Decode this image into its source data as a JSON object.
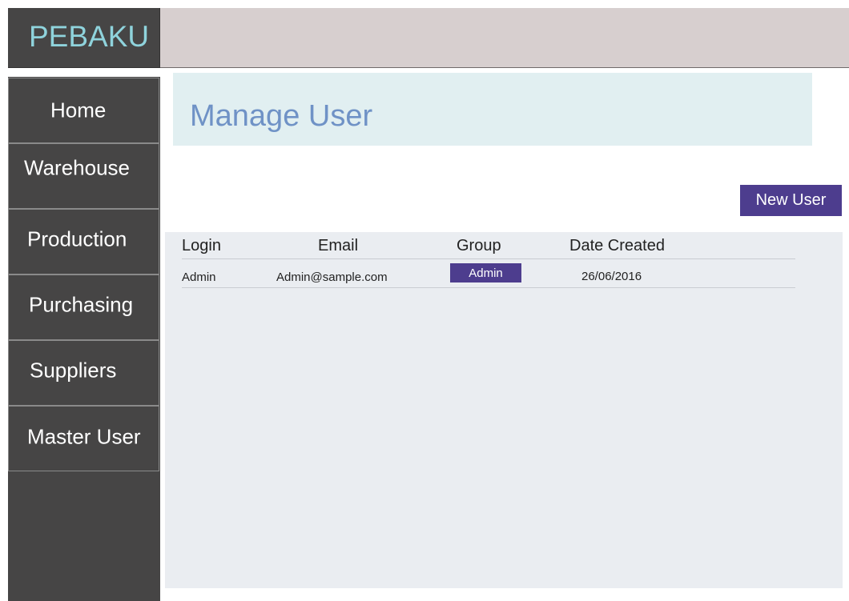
{
  "app": {
    "brand": "PEBAKU"
  },
  "sidebar": {
    "items": [
      {
        "label": "Home"
      },
      {
        "label": "Warehouse"
      },
      {
        "label": "Production"
      },
      {
        "label": "Purchasing"
      },
      {
        "label": "Suppliers"
      },
      {
        "label": "Master User"
      }
    ]
  },
  "main": {
    "title": "Manage User",
    "new_user_label": "New User",
    "table": {
      "columns": [
        "Login",
        "Email",
        "Group",
        "Date Created"
      ],
      "rows": [
        {
          "login": "Admin",
          "email": "Admin@sample.com",
          "group": "Admin",
          "date_created": "26/06/2016"
        }
      ]
    }
  },
  "colors": {
    "sidebar_bg": "#464545",
    "brand_text": "#8fd3dc",
    "topbar_bg": "#d7cfcf",
    "title_bg": "#e1eff1",
    "title_text": "#6f92c6",
    "accent": "#4d3d8e",
    "panel_bg": "#eaedf1"
  }
}
